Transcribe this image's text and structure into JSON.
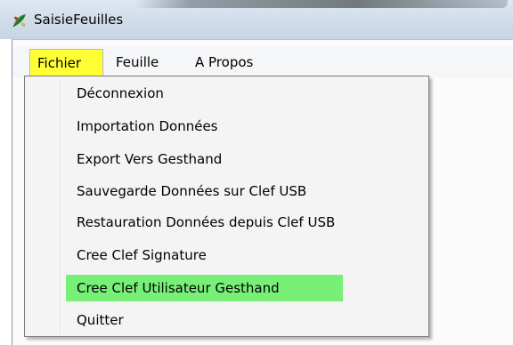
{
  "window": {
    "title": "SaisieFeuilles",
    "icon": "app-leaf-icon"
  },
  "menubar": {
    "items": [
      {
        "label": "Fichier",
        "active": true
      },
      {
        "label": "Feuille",
        "active": false
      },
      {
        "label": "A Propos",
        "active": false
      }
    ]
  },
  "dropdown": {
    "items": [
      {
        "label": "Déconnexion"
      },
      {
        "label": "Importation Données"
      },
      {
        "label": "Export Vers Gesthand"
      },
      {
        "label": "Sauvegarde Données sur Clef USB"
      },
      {
        "label": "Restauration Données depuis Clef USB"
      },
      {
        "label": "Cree Clef Signature"
      },
      {
        "label": "Cree Clef Utilisateur Gesthand",
        "highlighted": true
      },
      {
        "label": "Quitter"
      }
    ]
  },
  "colors": {
    "active_menu_bg": "#ffff33",
    "highlight_item_bg": "#78f078",
    "titlebar_bg": "#d1dce9"
  }
}
